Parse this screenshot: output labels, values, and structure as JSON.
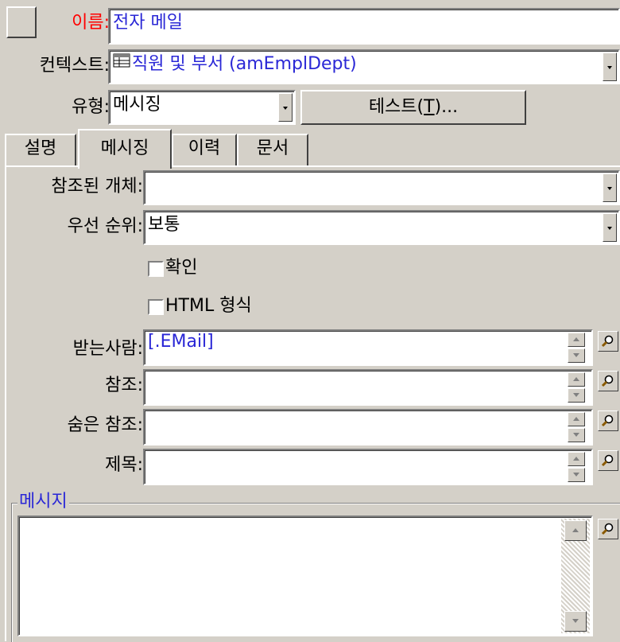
{
  "header": {
    "name_label": "이름:",
    "name_value": "전자 메일",
    "context_label": "컨텍스트:",
    "context_value": "직원 및 부서 (amEmplDept)",
    "type_label": "유형:",
    "type_value": "메시징",
    "test_button": "테스트(T)...",
    "test_button_hotkey_char": "T"
  },
  "tabs": [
    {
      "label": "설명"
    },
    {
      "label": "메시징"
    },
    {
      "label": "이력"
    },
    {
      "label": "문서"
    }
  ],
  "form": {
    "referenced_object_label": "참조된 개체:",
    "referenced_object_value": "",
    "priority_label": "우선 순위:",
    "priority_value": "보통",
    "confirm_label": "확인",
    "html_format_label": "HTML 형식",
    "to_label": "받는사람:",
    "to_value": "[.EMail]",
    "cc_label": "참조:",
    "cc_value": "",
    "bcc_label": "숨은 참조:",
    "bcc_value": "",
    "subject_label": "제목:",
    "subject_value": "",
    "message_group_label": "메시지",
    "message_value": ""
  },
  "colors": {
    "window_bg": "#d4d0c8",
    "field_text_blue": "#2a27d6",
    "required_label_red": "#ff0000"
  },
  "icons": [
    "table-icon",
    "magnifier-icon",
    "spin-up-icon",
    "spin-down-icon",
    "dropdown-arrow-icon"
  ]
}
